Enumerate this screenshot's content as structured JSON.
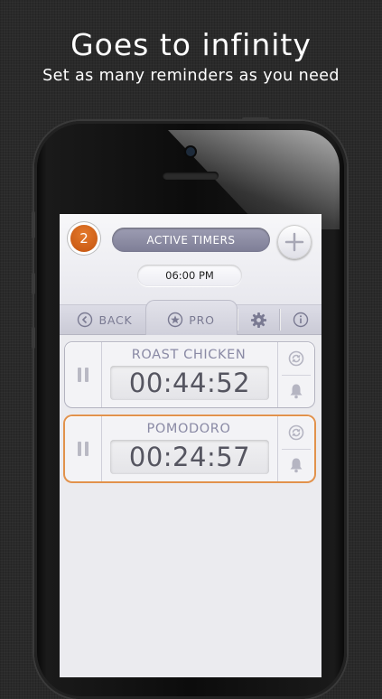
{
  "promo": {
    "title": "Goes to infinity",
    "subtitle": "Set as many reminders as you need"
  },
  "header": {
    "badge_count": "2",
    "active_label": "ACTIVE TIMERS",
    "time": "06:00 PM"
  },
  "nav": {
    "back": "BACK",
    "pro": "PRO"
  },
  "timers": [
    {
      "name": "ROAST CHICKEN",
      "time": "00:44:52",
      "active": false
    },
    {
      "name": "POMODORO",
      "time": "00:24:57",
      "active": true
    }
  ],
  "colors": {
    "accent_orange": "#d9661b",
    "active_border": "#e2924c",
    "pill": "#8c8ca3"
  }
}
